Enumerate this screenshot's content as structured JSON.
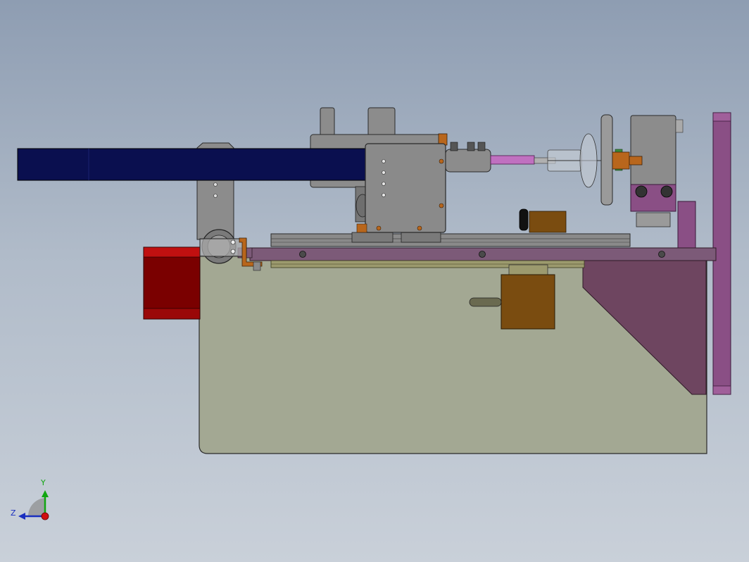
{
  "viewport": {
    "background_top": "#8e9db2",
    "background_bottom": "#c9d0d9"
  },
  "model": {
    "colors": {
      "base_plate": "#a3a893",
      "motor_red": "#7a0000",
      "arm_navy": "#0a0f4f",
      "frame_purple": "#8a4f85",
      "bracket_pink": "#6e4560",
      "steel": "#8a8a8a",
      "bronze": "#7a4c10",
      "orange_part": "#b8661c"
    },
    "parts": [
      "base-plate",
      "stepper-motor",
      "feed-arm",
      "spindle-housing",
      "linear-rail",
      "slide-rail",
      "chuck-assembly",
      "tailstock-block",
      "side-frame",
      "support-bracket",
      "adjust-knob",
      "pulley-wheel"
    ]
  },
  "triad": {
    "y_label": "Y",
    "z_label": "Z",
    "y_color": "#11a611",
    "z_color": "#1a2fbf",
    "origin_color": "#d01010"
  }
}
